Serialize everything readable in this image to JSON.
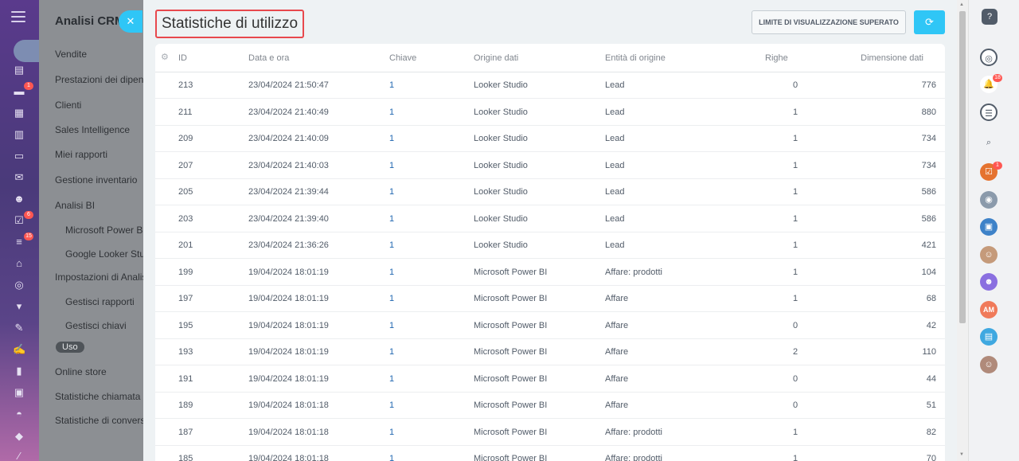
{
  "left_nav": {
    "badges": [
      "1",
      "6",
      "15"
    ]
  },
  "panel": {
    "title": "Analisi CRM",
    "items": [
      {
        "label": "Vendite"
      },
      {
        "label": "Prestazioni dei dipend"
      },
      {
        "label": "Clienti"
      },
      {
        "label": "Sales Intelligence"
      },
      {
        "label": "Miei rapporti"
      },
      {
        "label": "Gestione inventario"
      },
      {
        "label": "Analisi BI"
      },
      {
        "label": "Microsoft Power BI"
      },
      {
        "label": "Google Looker Stud"
      },
      {
        "label": "Impostazioni di Analisi"
      },
      {
        "label": "Gestisci rapporti"
      },
      {
        "label": "Gestisci chiavi"
      },
      {
        "label": "Uso"
      },
      {
        "label": "Online store"
      },
      {
        "label": "Statistiche chiamata"
      },
      {
        "label": "Statistiche di conversa"
      }
    ]
  },
  "header": {
    "title": "Statistiche di utilizzo",
    "limit_button": "LIMITE DI VISUALIZZAZIONE SUPERATO"
  },
  "table": {
    "columns": [
      "ID",
      "Data e ora",
      "Chiave",
      "Origine dati",
      "Entità di origine",
      "Righe",
      "Dimensione dati"
    ],
    "rows": [
      {
        "id": "213",
        "datetime": "23/04/2024 21:50:47",
        "key": "1",
        "source": "Looker Studio",
        "entity": "Lead",
        "rows": "0",
        "size": "776"
      },
      {
        "id": "211",
        "datetime": "23/04/2024 21:40:49",
        "key": "1",
        "source": "Looker Studio",
        "entity": "Lead",
        "rows": "1",
        "size": "880"
      },
      {
        "id": "209",
        "datetime": "23/04/2024 21:40:09",
        "key": "1",
        "source": "Looker Studio",
        "entity": "Lead",
        "rows": "1",
        "size": "734"
      },
      {
        "id": "207",
        "datetime": "23/04/2024 21:40:03",
        "key": "1",
        "source": "Looker Studio",
        "entity": "Lead",
        "rows": "1",
        "size": "734"
      },
      {
        "id": "205",
        "datetime": "23/04/2024 21:39:44",
        "key": "1",
        "source": "Looker Studio",
        "entity": "Lead",
        "rows": "1",
        "size": "586"
      },
      {
        "id": "203",
        "datetime": "23/04/2024 21:39:40",
        "key": "1",
        "source": "Looker Studio",
        "entity": "Lead",
        "rows": "1",
        "size": "586"
      },
      {
        "id": "201",
        "datetime": "23/04/2024 21:36:26",
        "key": "1",
        "source": "Looker Studio",
        "entity": "Lead",
        "rows": "1",
        "size": "421"
      },
      {
        "id": "199",
        "datetime": "19/04/2024 18:01:19",
        "key": "1",
        "source": "Microsoft Power BI",
        "entity": "Affare: prodotti",
        "rows": "1",
        "size": "104"
      },
      {
        "id": "197",
        "datetime": "19/04/2024 18:01:19",
        "key": "1",
        "source": "Microsoft Power BI",
        "entity": "Affare",
        "rows": "1",
        "size": "68"
      },
      {
        "id": "195",
        "datetime": "19/04/2024 18:01:19",
        "key": "1",
        "source": "Microsoft Power BI",
        "entity": "Affare",
        "rows": "0",
        "size": "42"
      },
      {
        "id": "193",
        "datetime": "19/04/2024 18:01:19",
        "key": "1",
        "source": "Microsoft Power BI",
        "entity": "Affare",
        "rows": "2",
        "size": "110"
      },
      {
        "id": "191",
        "datetime": "19/04/2024 18:01:19",
        "key": "1",
        "source": "Microsoft Power BI",
        "entity": "Affare",
        "rows": "0",
        "size": "44"
      },
      {
        "id": "189",
        "datetime": "19/04/2024 18:01:18",
        "key": "1",
        "source": "Microsoft Power BI",
        "entity": "Affare",
        "rows": "0",
        "size": "51"
      },
      {
        "id": "187",
        "datetime": "19/04/2024 18:01:18",
        "key": "1",
        "source": "Microsoft Power BI",
        "entity": "Affare: prodotti",
        "rows": "1",
        "size": "82"
      },
      {
        "id": "185",
        "datetime": "19/04/2024 18:01:18",
        "key": "1",
        "source": "Microsoft Power BI",
        "entity": "Affare: prodotti",
        "rows": "1",
        "size": "70"
      }
    ]
  },
  "right_bar": {
    "badges": [
      "18",
      "1"
    ],
    "avatar_initials": "AM"
  },
  "colors": {
    "accent": "#2fc6f6",
    "highlight_border": "#e8484d",
    "link": "#2067b0"
  }
}
